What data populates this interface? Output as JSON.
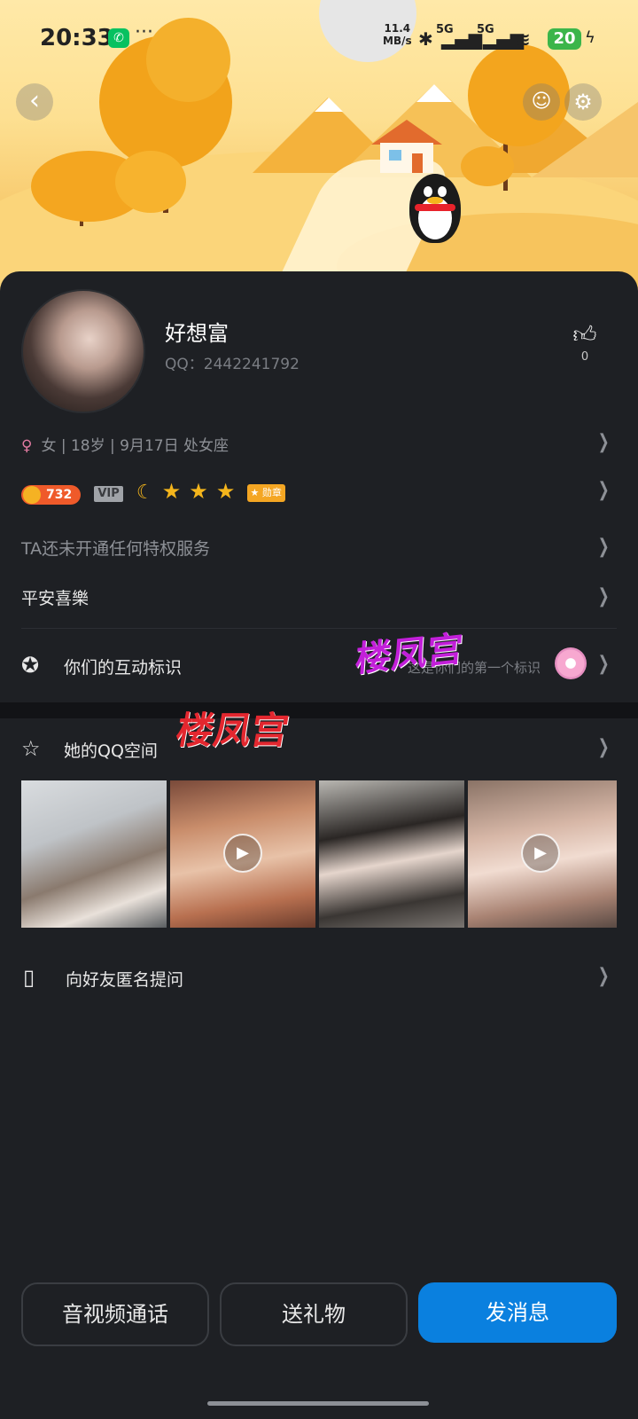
{
  "status_bar": {
    "time": "20:33",
    "speed_value": "11.4",
    "speed_unit": "MB/s",
    "network_a": "5G",
    "network_b": "5G",
    "battery": "20"
  },
  "header": {
    "back_icon": "back-chevron-icon",
    "pet_icon": "pet-face-icon",
    "settings_icon": "gear-icon"
  },
  "profile": {
    "nickname": "好想富",
    "qq_label": "QQ：2442241792",
    "likes": "0"
  },
  "info": {
    "gender_symbol": "♀",
    "text": "女  |  18岁  |  9月17日  处女座"
  },
  "level": {
    "coins": "732",
    "vip_label": "VIP",
    "medal_label": "勋章"
  },
  "privilege": {
    "text": "TA还未开通任何特权服务"
  },
  "signature": {
    "text": "平安喜樂"
  },
  "interaction": {
    "label": "你们的互动标识",
    "note": "这是你们的第一个标识"
  },
  "qzone": {
    "label": "她的QQ空间"
  },
  "ask": {
    "label": "向好友匿名提问"
  },
  "actions": {
    "call": "音视频通话",
    "gift": "送礼物",
    "message": "发消息"
  },
  "watermark": {
    "text": "楼凤宫"
  },
  "colors": {
    "background": "#1e2024",
    "accent_blue": "#0a80df",
    "female_pink": "#e07aa0",
    "watermark_red": "#e3272f",
    "watermark_purple": "#c21fd9"
  }
}
